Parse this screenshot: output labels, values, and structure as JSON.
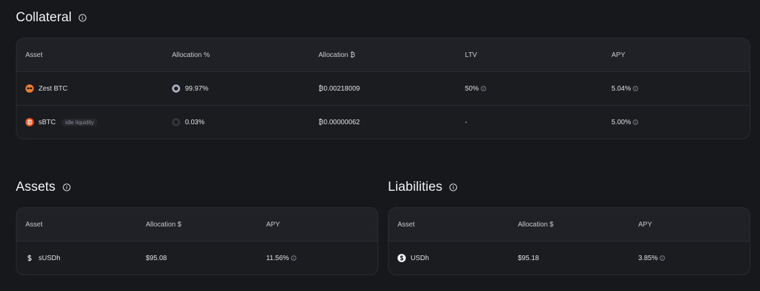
{
  "colors": {
    "background": "#17181b",
    "card": "#1b1c20",
    "header_row": "#202126",
    "border": "#2b2d33",
    "zest_orange": "#f07b2c",
    "sbtc_orange": "#f25a1d"
  },
  "collateral": {
    "title": "Collateral",
    "title_icon": "info-icon",
    "columns": [
      "Asset",
      "Allocation %",
      "Allocation ₿",
      "LTV",
      "APY"
    ],
    "rows": [
      {
        "asset": "Zest BTC",
        "asset_icon": "zest-icon",
        "tag": "",
        "allocation_pct": "99.97%",
        "allocation_pct_value": 99.97,
        "allocation_btc": "₿0.00218009",
        "ltv": "50%",
        "ltv_info": true,
        "apy": "5.04%"
      },
      {
        "asset": "sBTC",
        "asset_icon": "sbtc-icon",
        "tag": "idle liquidity",
        "allocation_pct": "0.03%",
        "allocation_pct_value": 0.03,
        "allocation_btc": "₿0.00000062",
        "ltv": "-",
        "ltv_info": false,
        "apy": "5.00%"
      }
    ]
  },
  "assets": {
    "title": "Assets",
    "title_icon": "info-icon",
    "columns": [
      "Asset",
      "Allocation $",
      "APY"
    ],
    "rows": [
      {
        "asset": "sUSDh",
        "asset_icon": "dollar-icon",
        "allocation": "$95.08",
        "apy": "11.56%"
      }
    ]
  },
  "liabilities": {
    "title": "Liabilities",
    "title_icon": "info-icon",
    "columns": [
      "Asset",
      "Allocation $",
      "APY"
    ],
    "rows": [
      {
        "asset": "USDh",
        "asset_icon": "usdh-icon",
        "allocation": "$95.18",
        "apy": "3.85%"
      }
    ]
  }
}
